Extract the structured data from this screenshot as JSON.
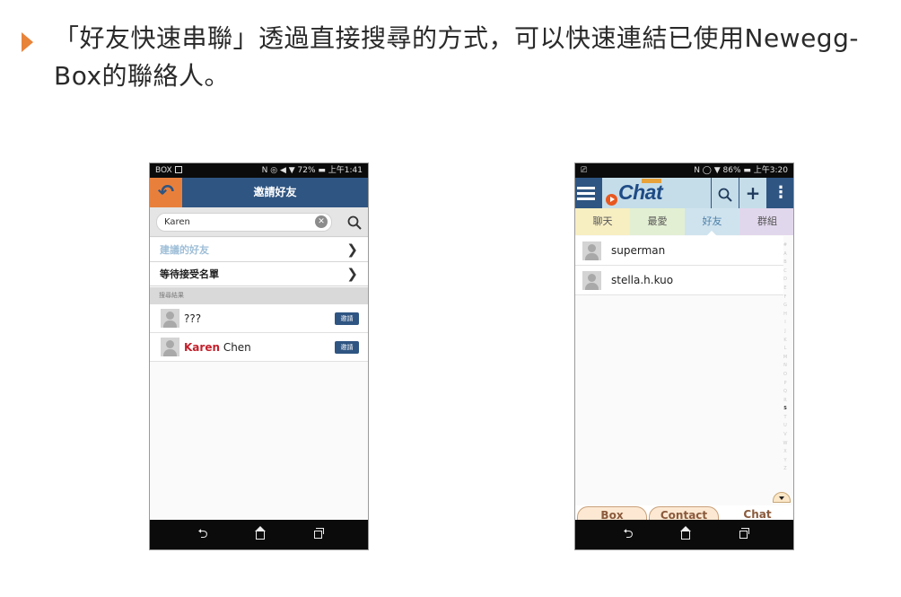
{
  "slide": {
    "title": "「好友快速串聯」透過直接搜尋的方式，可以快速連結已使用Newegg-Box的聯絡人。"
  },
  "left_phone": {
    "status": {
      "left": "BOX",
      "battery": "72%",
      "time": "上午1:41"
    },
    "header_title": "邀請好友",
    "back_icon": "undo-arrow-icon",
    "search": {
      "value": "Karen"
    },
    "menu": [
      {
        "label": "建議的好友"
      },
      {
        "label": "等待接受名單"
      }
    ],
    "section_label": "搜尋結果",
    "results": [
      {
        "name": "???",
        "highlight": "",
        "rest": "???",
        "button": "邀請"
      },
      {
        "name": "Karen Chen",
        "highlight": "Karen",
        "rest": " Chen",
        "button": "邀請"
      }
    ],
    "colors": {
      "header": "#2f5582",
      "back": "#e8803c",
      "match": "#c4202c"
    }
  },
  "right_phone": {
    "status": {
      "battery": "86%",
      "time": "上午3:20"
    },
    "logo": {
      "text": "Chat",
      "brand": "newegg"
    },
    "tabs": [
      {
        "label": "聊天"
      },
      {
        "label": "最愛"
      },
      {
        "label": "好友"
      },
      {
        "label": "群組"
      }
    ],
    "active_tab": "好友",
    "contacts": [
      {
        "name": "superman"
      },
      {
        "name": "stella.h.kuo"
      }
    ],
    "alpha_index": [
      "#",
      "A",
      "B",
      "C",
      "D",
      "E",
      "F",
      "G",
      "H",
      "I",
      "J",
      "K",
      "L",
      "M",
      "N",
      "O",
      "P",
      "Q",
      "R",
      "S",
      "T",
      "U",
      "V",
      "W",
      "X",
      "Y",
      "Z"
    ],
    "alpha_active": "S",
    "bottom_tabs": [
      {
        "label": "Box"
      },
      {
        "label": "Contact"
      },
      {
        "label": "Chat"
      }
    ]
  }
}
